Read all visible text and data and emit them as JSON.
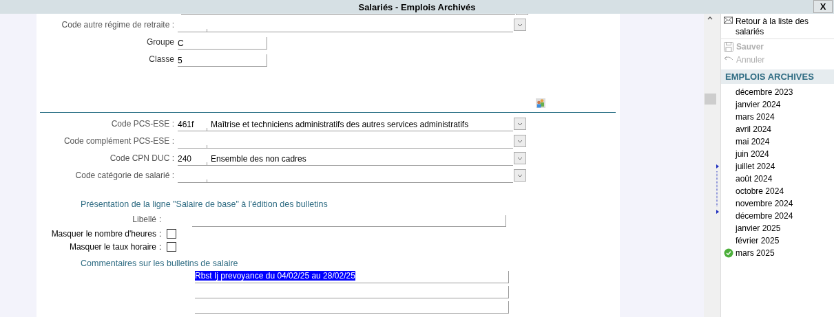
{
  "window": {
    "title": "Salariés - Emplois Archivés",
    "close": "X"
  },
  "upper_fields": [
    {
      "label": "Code autre régime de retraite :",
      "kind": "combo"
    },
    {
      "label": "Groupe",
      "kind": "text",
      "value": "C"
    },
    {
      "label": "Classe",
      "kind": "text",
      "value": "5"
    }
  ],
  "code_fields": [
    {
      "label": "Code PCS-ESE :",
      "kind": "combo",
      "code": "461f",
      "description": "Maîtrise et techniciens administratifs des autres services administratifs"
    },
    {
      "label": "Code complément PCS-ESE :",
      "kind": "combo"
    },
    {
      "label": "Code CPN DUC :",
      "kind": "combo",
      "code": "240",
      "description": "Ensemble des non cadres"
    },
    {
      "label": "Code catégorie de salarié :",
      "kind": "combo"
    }
  ],
  "base_salary": {
    "heading": "Présentation de la ligne \"Salaire de base\" à l'édition des bulletins",
    "libelle": {
      "label": "Libellé",
      "colon": ":"
    },
    "options": [
      {
        "label": "Masquer le nombre d'heures",
        "colon": ":",
        "checked": false
      },
      {
        "label": "Masquer le taux horaire",
        "colon": ":",
        "checked": false
      }
    ]
  },
  "comments": {
    "heading": "Commentaires sur les bulletins de salaire",
    "lines": [
      {
        "value": "Rbst Ij prevoyance du 04/02/25 au 28/02/25",
        "selected": true
      },
      {
        "selected": false
      },
      {
        "selected": false
      }
    ]
  },
  "sidebar": {
    "actions": [
      {
        "label": "Retour à la liste des salariés",
        "kind": "return",
        "disabled": false,
        "bold": false
      },
      {
        "label": "Sauver",
        "kind": "save",
        "disabled": true,
        "bold": true
      },
      {
        "label": "Annuler",
        "kind": "undo",
        "disabled": true,
        "bold": false
      }
    ],
    "section": "EMPLOIS ARCHIVES",
    "items": [
      {
        "label": "décembre 2023",
        "selected": false
      },
      {
        "label": "janvier 2024",
        "selected": false
      },
      {
        "label": "mars 2024",
        "selected": false
      },
      {
        "label": "avril 2024",
        "selected": false
      },
      {
        "label": "mai 2024",
        "selected": false
      },
      {
        "label": "juin 2024",
        "selected": false
      },
      {
        "label": "juillet 2024",
        "selected": false
      },
      {
        "label": "août 2024",
        "selected": false
      },
      {
        "label": "octobre 2024",
        "selected": false
      },
      {
        "label": "novembre 2024",
        "selected": false
      },
      {
        "label": "décembre 2024",
        "selected": false
      },
      {
        "label": "janvier 2025",
        "selected": false
      },
      {
        "label": "février 2025",
        "selected": false
      },
      {
        "label": "mars 2025",
        "selected": true
      }
    ]
  }
}
